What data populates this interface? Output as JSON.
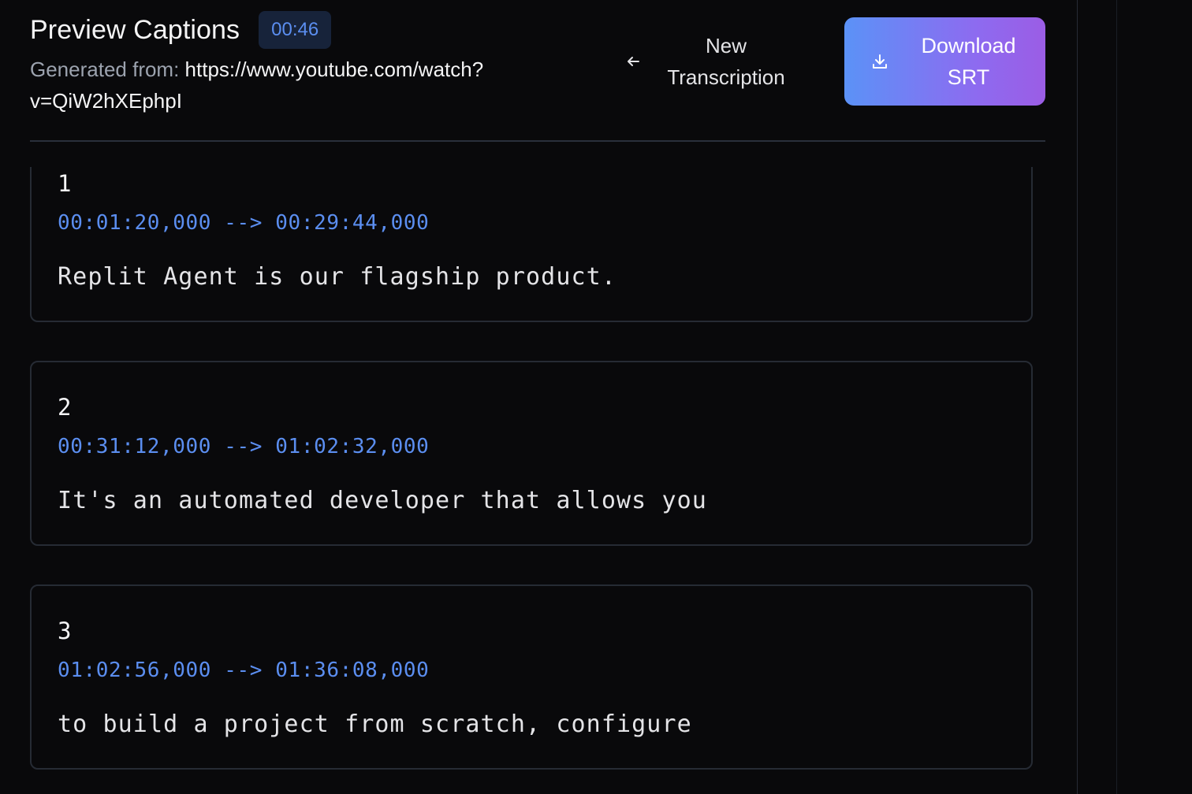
{
  "header": {
    "title": "Preview Captions",
    "timer": "00:46",
    "source_label": "Generated from:",
    "source_url": "https://www.youtube.com/watch?v=QiW2hXEphpI"
  },
  "actions": {
    "new_transcription": {
      "line1": "New",
      "line2": "Transcription",
      "icon": "arrow-left-icon"
    },
    "download": {
      "line1": "Download",
      "line2": "SRT",
      "icon": "download-icon"
    }
  },
  "colors": {
    "background": "#09090b",
    "accent_blue": "#5b8ef0",
    "gradient_start": "#5b92f7",
    "gradient_end": "#9b5de5",
    "card_border": "#262b34"
  },
  "captions": [
    {
      "index": "1",
      "time": "00:01:20,000 --> 00:29:44,000",
      "text": "Replit Agent is our flagship product."
    },
    {
      "index": "2",
      "time": "00:31:12,000 --> 01:02:32,000",
      "text": "It's an automated developer that allows you"
    },
    {
      "index": "3",
      "time": "01:02:56,000 --> 01:36:08,000",
      "text": "to build a project from scratch, configure"
    }
  ]
}
